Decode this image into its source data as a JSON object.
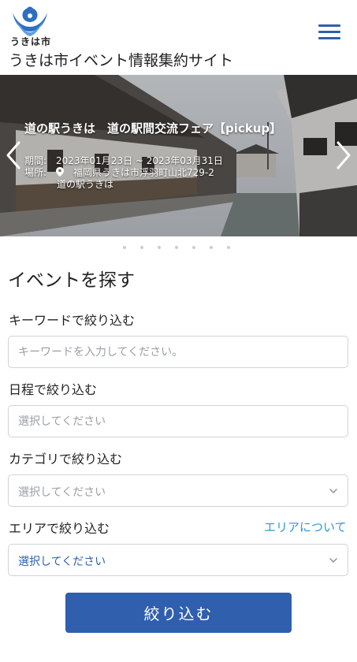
{
  "header": {
    "logo_text": "うきは市",
    "site_title": "うきは市イベント情報集約サイト"
  },
  "hero": {
    "title": "道の駅うきは　道の駅間交流フェア【pickup】",
    "period_label": "期間:",
    "period_value": "2023年01月23日 ~ 2023年03月31日",
    "place_label": "場所:",
    "address": "福岡県うきは市浮羽町山北729-2",
    "venue": "道の駅うきは"
  },
  "search": {
    "title": "イベントを探す",
    "keyword": {
      "label": "キーワードで絞り込む",
      "placeholder": "キーワードを入力してください。"
    },
    "date": {
      "label": "日程で絞り込む",
      "placeholder": "選択してください"
    },
    "category": {
      "label": "カテゴリで絞り込む",
      "value": "選択してください"
    },
    "area": {
      "label": "エリアで絞り込む",
      "link": "エリアについて",
      "value": "選択してください"
    },
    "submit_label": "絞り込む"
  },
  "icons": {
    "menu": "hamburger-menu-icon",
    "prev": "chevron-left-icon",
    "next": "chevron-right-icon",
    "pin": "map-pin-icon",
    "dropdown": "chevron-down-icon"
  },
  "colors": {
    "brand": "#2f5fad",
    "link": "#2a9ad1",
    "border": "#cfd3d8",
    "placeholder": "#9a9fa6"
  }
}
